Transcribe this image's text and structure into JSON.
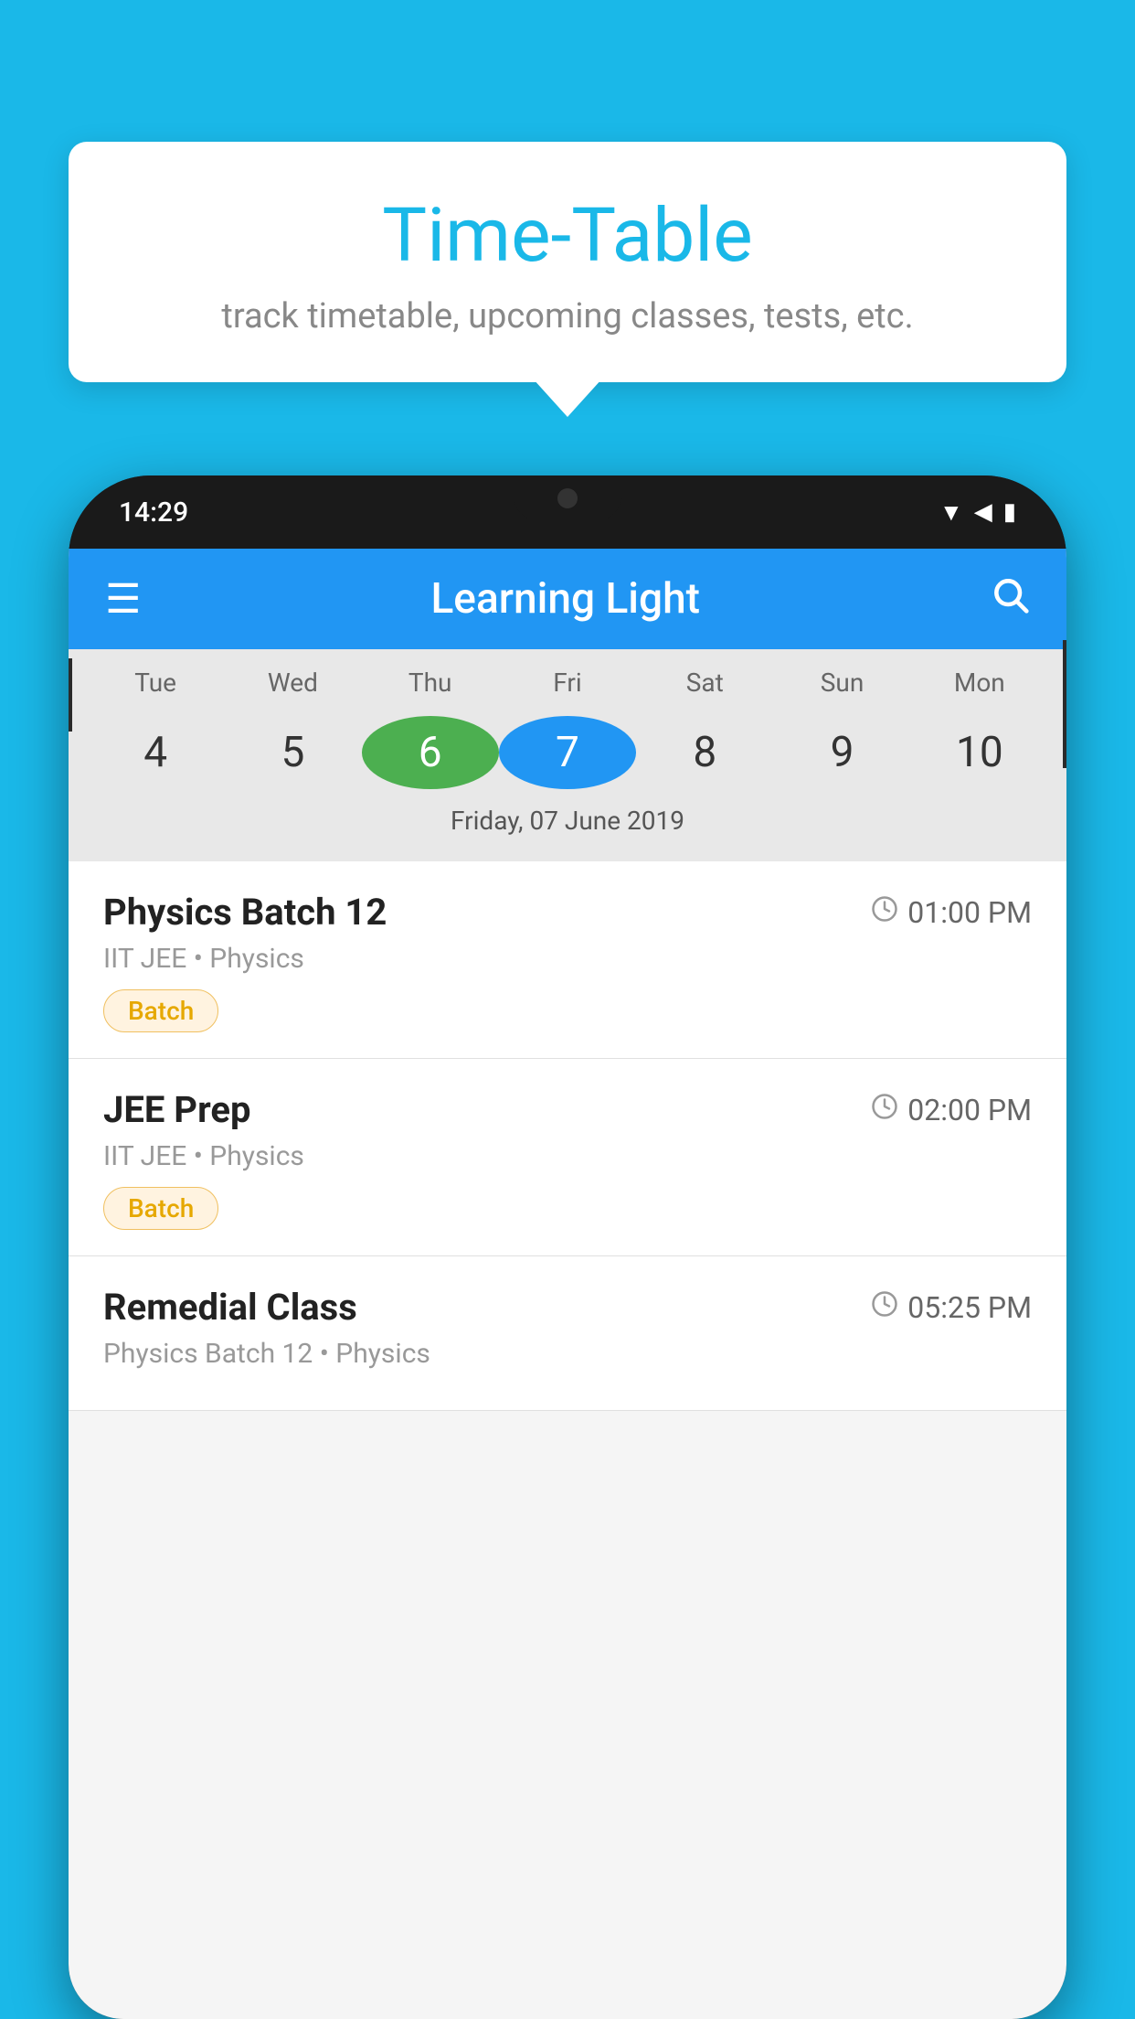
{
  "background_color": "#1ab8e8",
  "tooltip": {
    "title": "Time-Table",
    "subtitle": "track timetable, upcoming classes, tests, etc."
  },
  "phone": {
    "status_bar": {
      "time": "14:29",
      "icons": [
        "wifi",
        "signal",
        "battery"
      ]
    },
    "toolbar": {
      "title": "Learning Light",
      "menu_icon": "☰",
      "search_icon": "🔍"
    },
    "calendar": {
      "days": [
        {
          "label": "Tue",
          "number": "4"
        },
        {
          "label": "Wed",
          "number": "5"
        },
        {
          "label": "Thu",
          "number": "6",
          "state": "today"
        },
        {
          "label": "Fri",
          "number": "7",
          "state": "selected"
        },
        {
          "label": "Sat",
          "number": "8"
        },
        {
          "label": "Sun",
          "number": "9"
        },
        {
          "label": "Mon",
          "number": "10"
        }
      ],
      "selected_date_label": "Friday, 07 June 2019"
    },
    "classes": [
      {
        "name": "Physics Batch 12",
        "time": "01:00 PM",
        "subject": "IIT JEE • Physics",
        "badge": "Batch"
      },
      {
        "name": "JEE Prep",
        "time": "02:00 PM",
        "subject": "IIT JEE • Physics",
        "badge": "Batch"
      },
      {
        "name": "Remedial Class",
        "time": "05:25 PM",
        "subject": "Physics Batch 12 • Physics",
        "badge": null
      }
    ]
  }
}
